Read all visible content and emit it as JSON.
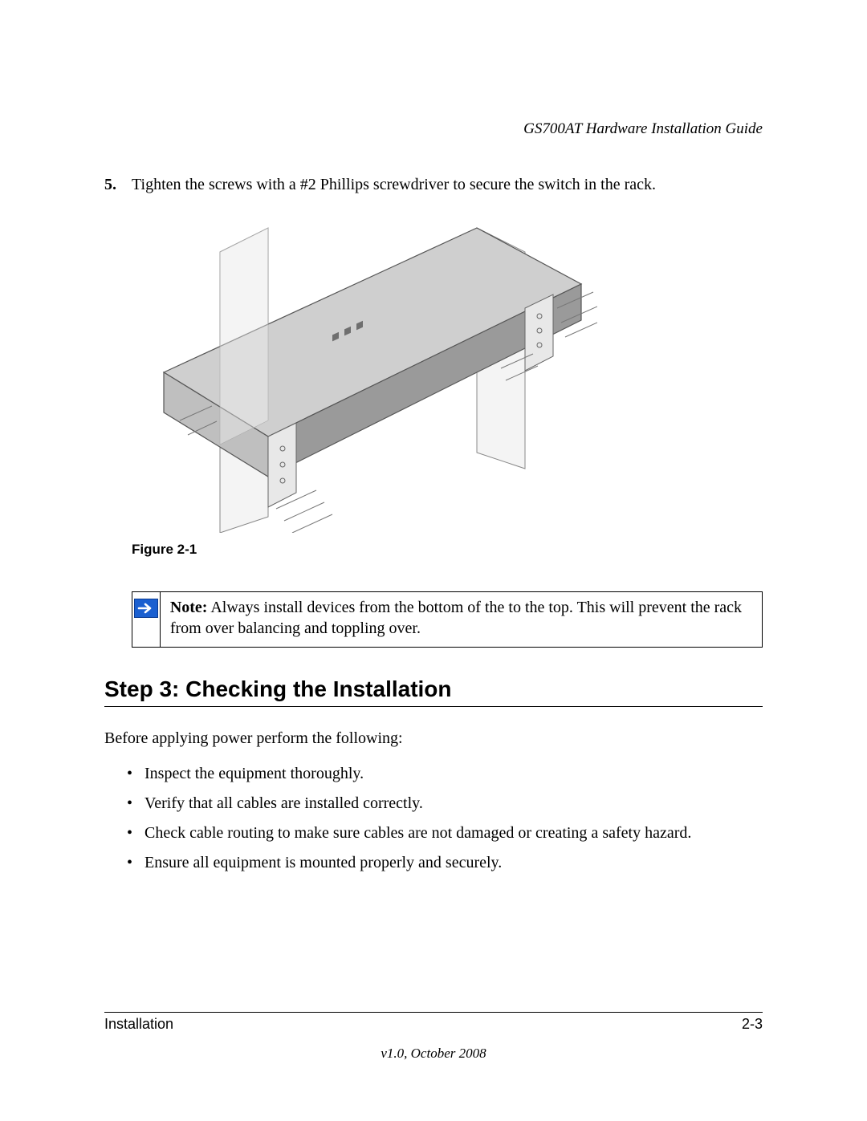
{
  "header": {
    "doc_title": "GS700AT Hardware Installation Guide"
  },
  "step": {
    "number": "5.",
    "text": "Tighten the screws with a #2 Phillips screwdriver to secure the switch in the rack."
  },
  "figure": {
    "caption": "Figure 2-1"
  },
  "note": {
    "lead": "Note:",
    "text": " Always install devices from the bottom of the to the top. This will prevent the rack from over balancing and toppling over."
  },
  "section": {
    "heading": "Step 3: Checking the Installation",
    "intro": "Before applying power perform the following:",
    "items": [
      "Inspect the equipment thoroughly.",
      "Verify that all cables are installed correctly.",
      "Check cable routing to make sure cables are not damaged or creating a safety hazard.",
      "Ensure all equipment is mounted properly and securely."
    ]
  },
  "footer": {
    "section_name": "Installation",
    "page": "2-3",
    "version": "v1.0, October 2008"
  }
}
